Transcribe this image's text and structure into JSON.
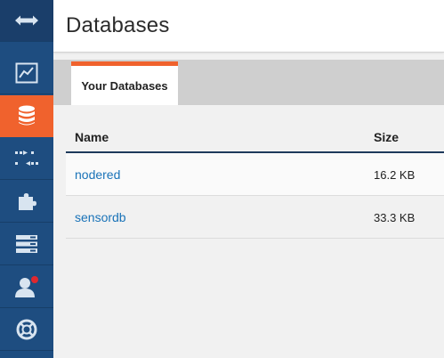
{
  "header": {
    "title": "Databases"
  },
  "tabs": [
    {
      "label": "Your Databases",
      "active": true
    }
  ],
  "table": {
    "columns": {
      "name": "Name",
      "size": "Size"
    },
    "rows": [
      {
        "name": "nodered",
        "size": "16.2 KB"
      },
      {
        "name": "sensordb",
        "size": "33.3 KB"
      }
    ]
  },
  "sidebar": {
    "items": [
      {
        "icon": "expand-arrows-icon"
      },
      {
        "icon": "activity-chart-icon"
      },
      {
        "icon": "database-icon",
        "active": true
      },
      {
        "icon": "replication-icon"
      },
      {
        "icon": "puzzle-icon"
      },
      {
        "icon": "config-icon"
      },
      {
        "icon": "user-icon",
        "notification": true
      },
      {
        "icon": "help-lifebuoy-icon"
      }
    ]
  },
  "colors": {
    "sidebar_bg": "#1e4d80",
    "accent": "#f0622d",
    "link": "#1a73b8",
    "notification": "#e0282e"
  }
}
